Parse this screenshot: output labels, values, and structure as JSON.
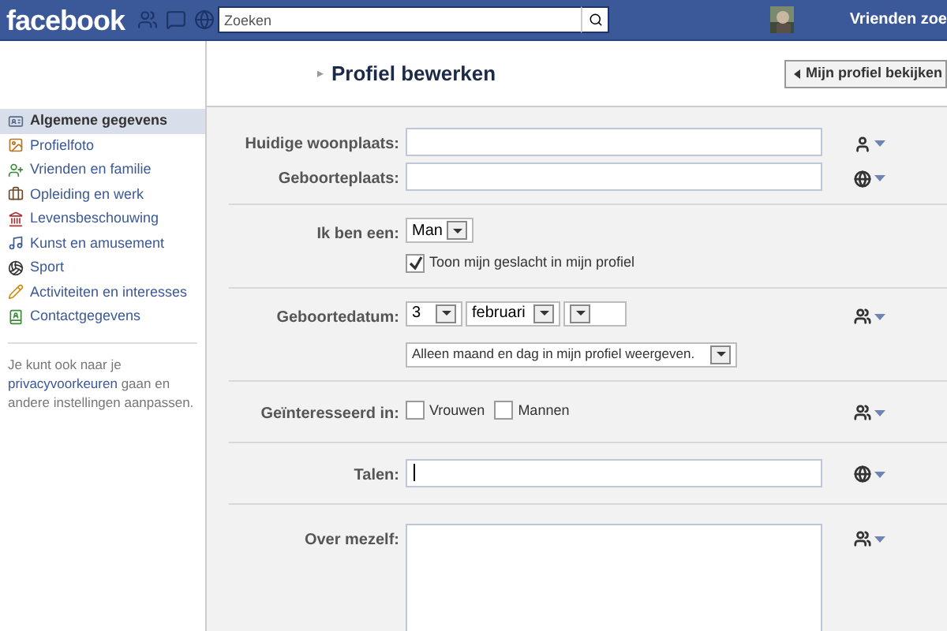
{
  "topbar": {
    "logo": "facebook",
    "search": {
      "placeholder": "Zoeken"
    },
    "find_friends": "Vrienden zoe"
  },
  "sidebar": {
    "items": [
      {
        "label": "Algemene gegevens",
        "selected": true
      },
      {
        "label": "Profielfoto",
        "selected": false
      },
      {
        "label": "Vrienden en familie",
        "selected": false
      },
      {
        "label": "Opleiding en werk",
        "selected": false
      },
      {
        "label": "Levensbeschouwing",
        "selected": false
      },
      {
        "label": "Kunst en amusement",
        "selected": false
      },
      {
        "label": "Sport",
        "selected": false
      },
      {
        "label": "Activiteiten en interesses",
        "selected": false
      },
      {
        "label": "Contactgegevens",
        "selected": false
      }
    ],
    "footer": {
      "before": "Je kunt ook naar je",
      "link": "privacyvoorkeuren",
      "after": "gaan en andere instellingen aanpassen."
    }
  },
  "header": {
    "marker": "▸",
    "title": "Profiel bewerken",
    "view_button": "Mijn profiel bekijken"
  },
  "sections": [
    {
      "rows": [
        {
          "kind": "text",
          "label": "Huidige woonplaats:",
          "privacy": {
            "kind": "person"
          }
        },
        {
          "kind": "text",
          "label": "Geboorteplaats:",
          "privacy": {
            "kind": "globe"
          }
        }
      ]
    },
    {
      "rows": [
        {
          "kind": "gender",
          "label": "Ik ben een:",
          "value": "Man",
          "checkbox": {
            "label": "Toon mijn geslacht in mijn profiel",
            "checked": true
          }
        }
      ]
    },
    {
      "rows": [
        {
          "kind": "date",
          "label": "Geboortedatum:",
          "selects": [
            {
              "kind": "day",
              "value": "3"
            },
            {
              "kind": "month",
              "value": "februari"
            },
            {
              "kind": "year"
            }
          ],
          "display": "Alleen maand en dag in mijn profiel weergeven.",
          "privacy": {
            "kind": "friends"
          }
        }
      ]
    },
    {
      "rows": [
        {
          "kind": "checks",
          "label": "Geïnteresseerd in:",
          "options": [
            {
              "label": "Vrouwen",
              "checked": false
            },
            {
              "label": "Mannen",
              "checked": false
            }
          ],
          "privacy": {
            "kind": "friends"
          }
        }
      ]
    },
    {
      "rows": [
        {
          "kind": "text",
          "label": "Talen:",
          "focused": true,
          "privacy": {
            "kind": "globe"
          }
        }
      ]
    },
    {
      "rows": [
        {
          "kind": "textarea",
          "label": "Over mezelf:",
          "privacy": {
            "kind": "friends"
          }
        }
      ]
    }
  ]
}
